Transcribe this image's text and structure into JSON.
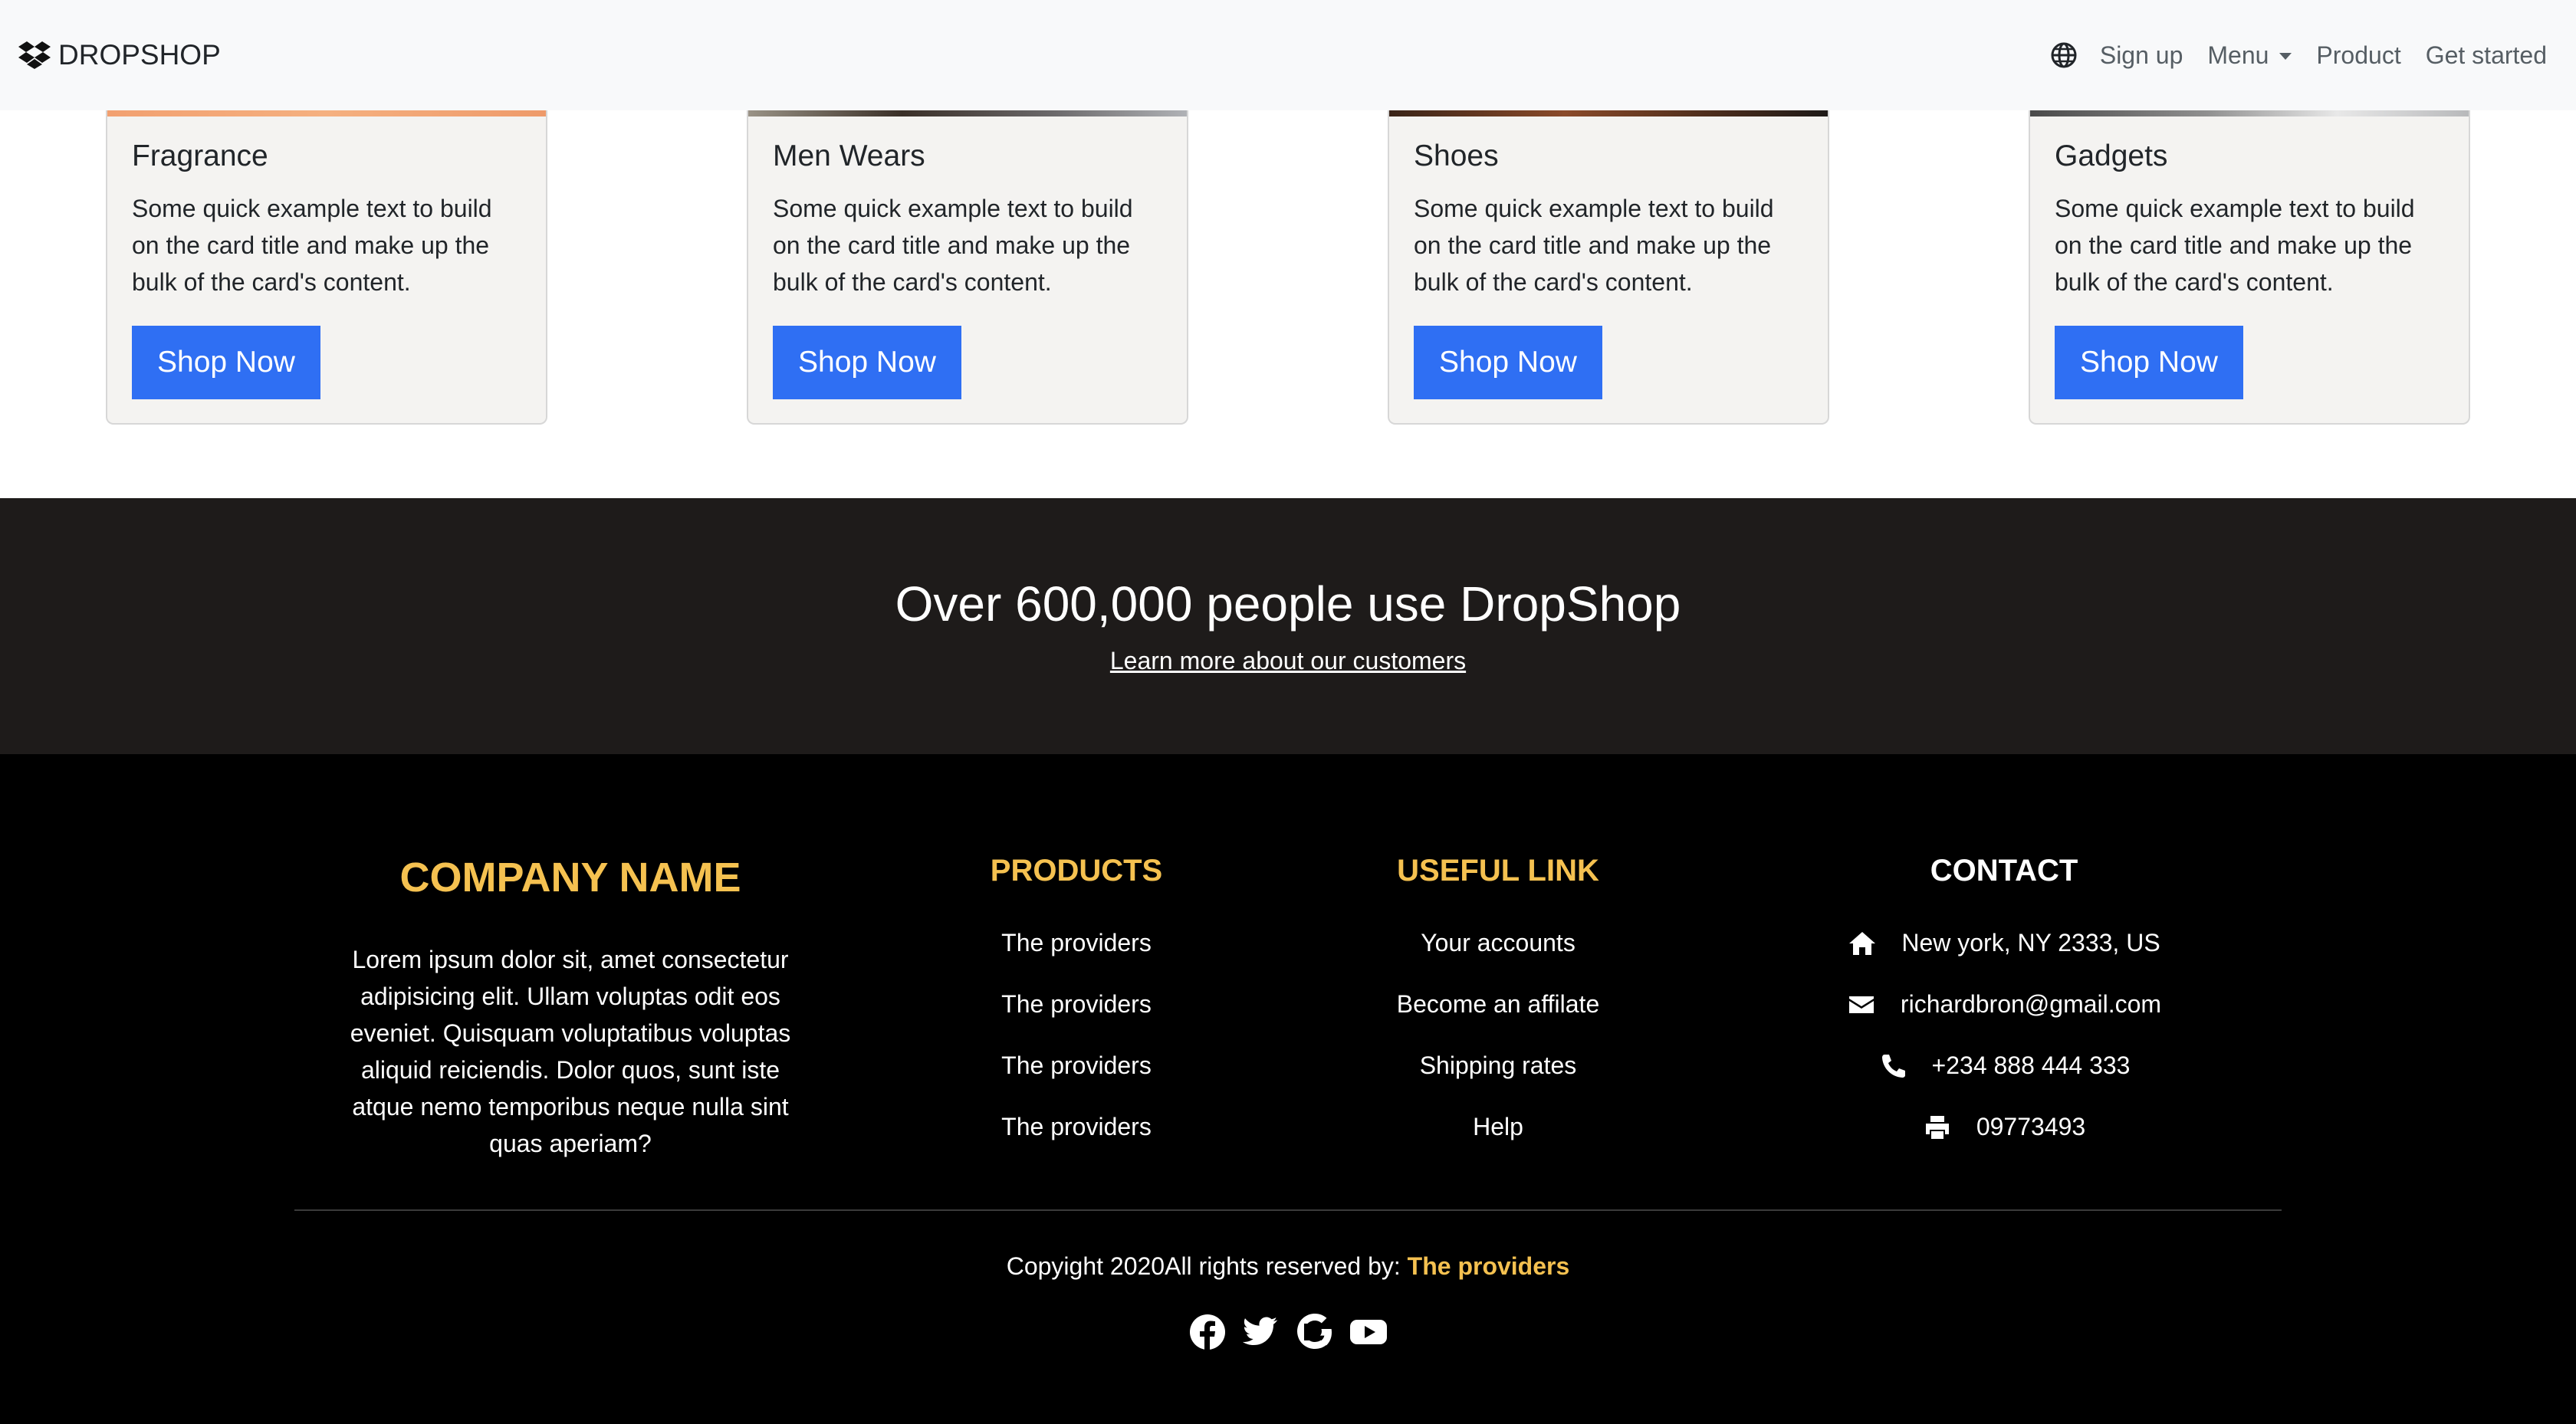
{
  "navbar": {
    "brand": "DROPSHOP",
    "links": [
      "Sign up",
      "Menu",
      "Product",
      "Get started"
    ]
  },
  "cards": [
    {
      "title": "Fragrance",
      "text": "Some quick example text to build on the card title and make up the bulk of the card's content.",
      "button": "Shop Now"
    },
    {
      "title": "Men Wears",
      "text": "Some quick example text to build on the card title and make up the bulk of the card's content.",
      "button": "Shop Now"
    },
    {
      "title": "Shoes",
      "text": "Some quick example text to build on the card title and make up the bulk of the card's content.",
      "button": "Shop Now"
    },
    {
      "title": "Gadgets",
      "text": "Some quick example text to build on the card title and make up the bulk of the card's content.",
      "button": "Shop Now"
    }
  ],
  "banner": {
    "title": "Over 600,000 people use DropShop",
    "link": "Learn more about our customers"
  },
  "footer": {
    "company_title": "COMPANY NAME",
    "company_text": "Lorem ipsum dolor sit, amet consectetur adipisicing elit. Ullam voluptas odit eos eveniet. Quisquam voluptatibus voluptas aliquid reiciendis. Dolor quos, sunt iste atque nemo temporibus neque nulla sint quas aperiam?",
    "products": {
      "heading": "PRODUCTS",
      "items": [
        "The providers",
        "The providers",
        "The providers",
        "The providers"
      ]
    },
    "useful": {
      "heading": "USEFUL LINK",
      "items": [
        "Your accounts",
        "Become an affilate",
        "Shipping rates",
        "Help"
      ]
    },
    "contact": {
      "heading": "CONTACT",
      "address": "New york, NY 2333, US",
      "email": "richardbron@gmail.com",
      "phone": "+234 888 444 333",
      "fax": "09773493"
    },
    "copyright_prefix": "Copyight 2020All rights reserved by:",
    "copyright_name": "The providers",
    "socials": [
      "facebook-icon",
      "twitter-icon",
      "google-icon",
      "youtube-icon"
    ]
  },
  "colors": {
    "accent_yellow": "#f5c150",
    "button_blue": "#2f6ff3",
    "banner_bg": "#1e1b1a",
    "footer_bg": "#000000",
    "card_strip": [
      "#f2a070",
      "#8c8476",
      "#5a3320",
      "#b8b9bb"
    ]
  }
}
